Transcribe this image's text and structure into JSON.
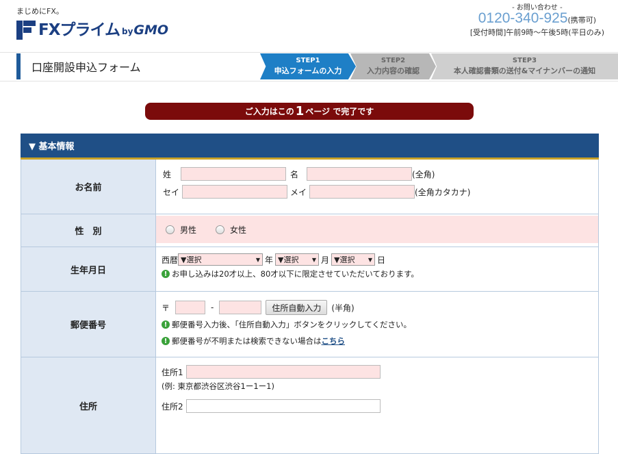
{
  "header": {
    "tagline": "まじめにFX。",
    "logo": {
      "text": "FXプライム",
      "by": "by",
      "brand": "GMO"
    },
    "contact": {
      "label": "- お問い合わせ -",
      "phone": "0120-340-925",
      "phone_note": "(携帯可)",
      "hours": "[受付時間]午前9時〜午後5時(平日のみ)"
    }
  },
  "page_title": "口座開設申込フォーム",
  "steps": [
    {
      "num": "STEP1",
      "label": "申込フォームの入力"
    },
    {
      "num": "STEP2",
      "label": "入力内容の確認"
    },
    {
      "num": "STEP3",
      "label": "本人確認書類の送付&マイナンバーの通知"
    }
  ],
  "banner": {
    "pre": "ご入力はこの",
    "big": "1",
    "post": "ページ で完了です"
  },
  "section": {
    "title": "▼ 基本情報"
  },
  "fields": {
    "name": {
      "label": "お名前",
      "sei": "姓",
      "mei": "名",
      "note_kanji": "(全角)",
      "sei_kana": "セイ",
      "mei_kana": "メイ",
      "note_kana": "(全角カタカナ)"
    },
    "gender": {
      "label": "性　別",
      "male": "男性",
      "female": "女性"
    },
    "birthday": {
      "label": "生年月日",
      "era": "西暦",
      "year_select": "▼選択",
      "year_unit": "年",
      "month_select": "▼選択",
      "month_unit": "月",
      "day_select": "▼選択",
      "day_unit": "日",
      "hint": "お申し込みは20才以上、80才以下に限定させていただいております。"
    },
    "postal": {
      "label": "郵便番号",
      "mark": "〒",
      "dash": "-",
      "button": "住所自動入力",
      "note": "(半角)",
      "hint1": "郵便番号入力後、「住所自動入力」ボタンをクリックしてください。",
      "hint2_pre": "郵便番号が不明または検索できない場合は",
      "hint2_link": "こちら"
    },
    "address": {
      "label": "住所",
      "addr1": "住所1",
      "example": "(例: 東京都渋谷区渋谷1ー1ー1)",
      "addr2": "住所2"
    }
  },
  "colors": {
    "accent": "#1f4f86",
    "step_active": "#1e7fc6",
    "banner": "#7b0b0b",
    "input_bg": "#fde3e3"
  }
}
